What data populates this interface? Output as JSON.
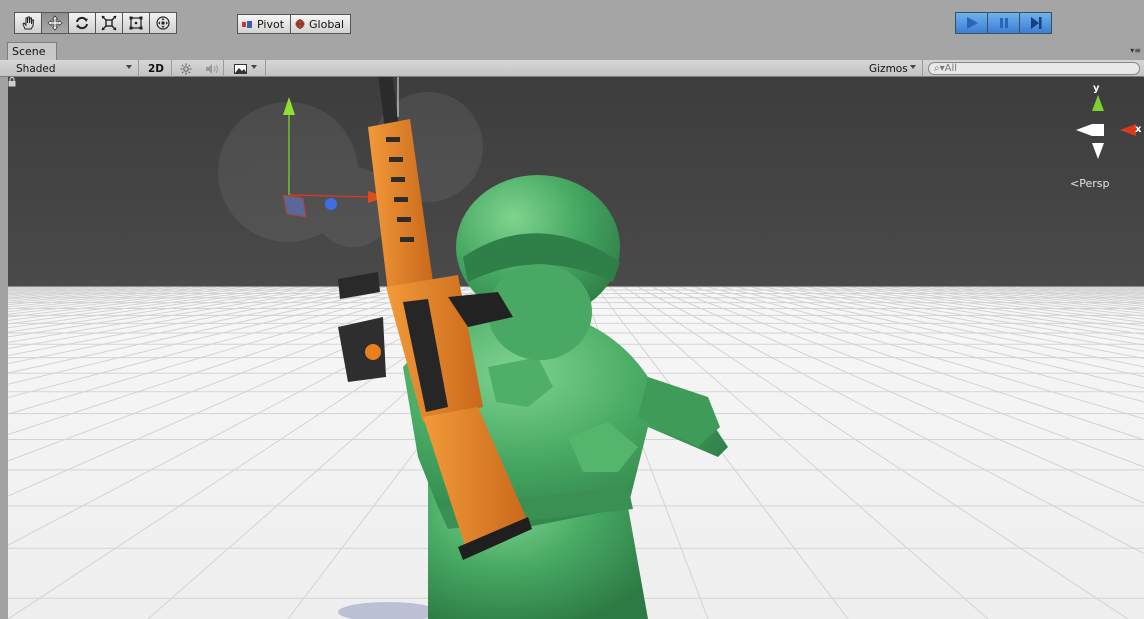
{
  "toolbar": {
    "tools": [
      {
        "name": "hand-tool-icon",
        "active": false
      },
      {
        "name": "move-tool-icon",
        "active": true
      },
      {
        "name": "rotate-tool-icon",
        "active": false
      },
      {
        "name": "scale-tool-icon",
        "active": false
      },
      {
        "name": "rect-tool-icon",
        "active": false
      },
      {
        "name": "transform-tool-icon",
        "active": false
      }
    ],
    "pivot_label": "Pivot",
    "global_label": "Global",
    "play_controls": [
      "play-icon",
      "pause-icon",
      "step-icon"
    ]
  },
  "scene_tab": {
    "label": "Scene"
  },
  "scene_toolbar": {
    "draw_mode": "Shaded",
    "mode_2d": "2D",
    "gizmos_label": "Gizmos",
    "search_placeholder": "All"
  },
  "scene_gizmo": {
    "y_axis": "y",
    "x_axis": "x",
    "projection": "Persp"
  },
  "colors": {
    "sky": "#424242",
    "ground": "#f4f4f4",
    "soldier": "#3f9e5a",
    "rifle": "#e8801e",
    "play_blue": "#3c7fd4"
  }
}
